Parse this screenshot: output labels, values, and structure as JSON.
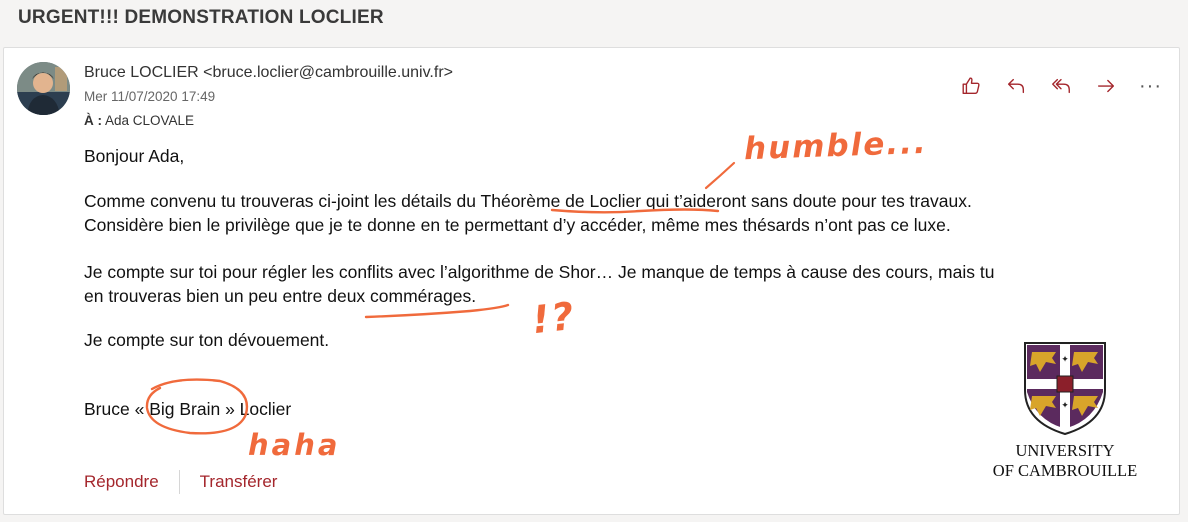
{
  "subject": "URGENT!!! DEMONSTRATION LOCLIER",
  "message": {
    "sender": "Bruce LOCLIER <bruce.loclier@cambrouille.univ.fr>",
    "date": "Mer 11/07/2020 17:49",
    "to_label": "À :",
    "to_value": "Ada CLOVALE",
    "body": {
      "greeting": "Bonjour Ada,",
      "p1_before": "Comme convenu tu trouveras ci-joint les détails du ",
      "p1_highlight": "Théorème de Loclier",
      "p1_after": " qui t’aideront sans doute pour tes travaux.",
      "p1_line2": "Considère bien le privilège que je te donne en te permettant d’y accéder, même mes thésards n’ont pas ce luxe.",
      "p2_line1": "Je compte sur toi pour régler les conflits avec l’algorithme de Shor… Je manque de temps à cause des cours, mais tu",
      "p2_line2_before": "en trouveras bien un peu entre ",
      "p2_line2_highlight": "deux commérages",
      "p2_line2_after": ".",
      "p3": "Je compte sur ton dévouement.",
      "sig_before": "Bruce « ",
      "sig_highlight": "Big Brain",
      "sig_after": " » Loclier"
    }
  },
  "actions": [
    {
      "name": "like",
      "icon": "thumbs-up-icon"
    },
    {
      "name": "reply",
      "icon": "reply-icon"
    },
    {
      "name": "reply-all",
      "icon": "reply-all-icon"
    },
    {
      "name": "forward",
      "icon": "forward-icon"
    },
    {
      "name": "more",
      "icon": "more-icon",
      "label": "···"
    }
  ],
  "footer": {
    "reply_label": "Répondre",
    "forward_label": "Transférer"
  },
  "university": {
    "line1": "UNIVERSITY",
    "line2": "OF CAMBROUILLE"
  },
  "annotations": {
    "humble": "humble...",
    "exclaim": "!?",
    "haha": "haha"
  },
  "colors": {
    "accent": "#a4262c",
    "annotation": "#f06a3c",
    "shield_purple": "#5b2a5e",
    "shield_gold": "#d8a42a"
  }
}
